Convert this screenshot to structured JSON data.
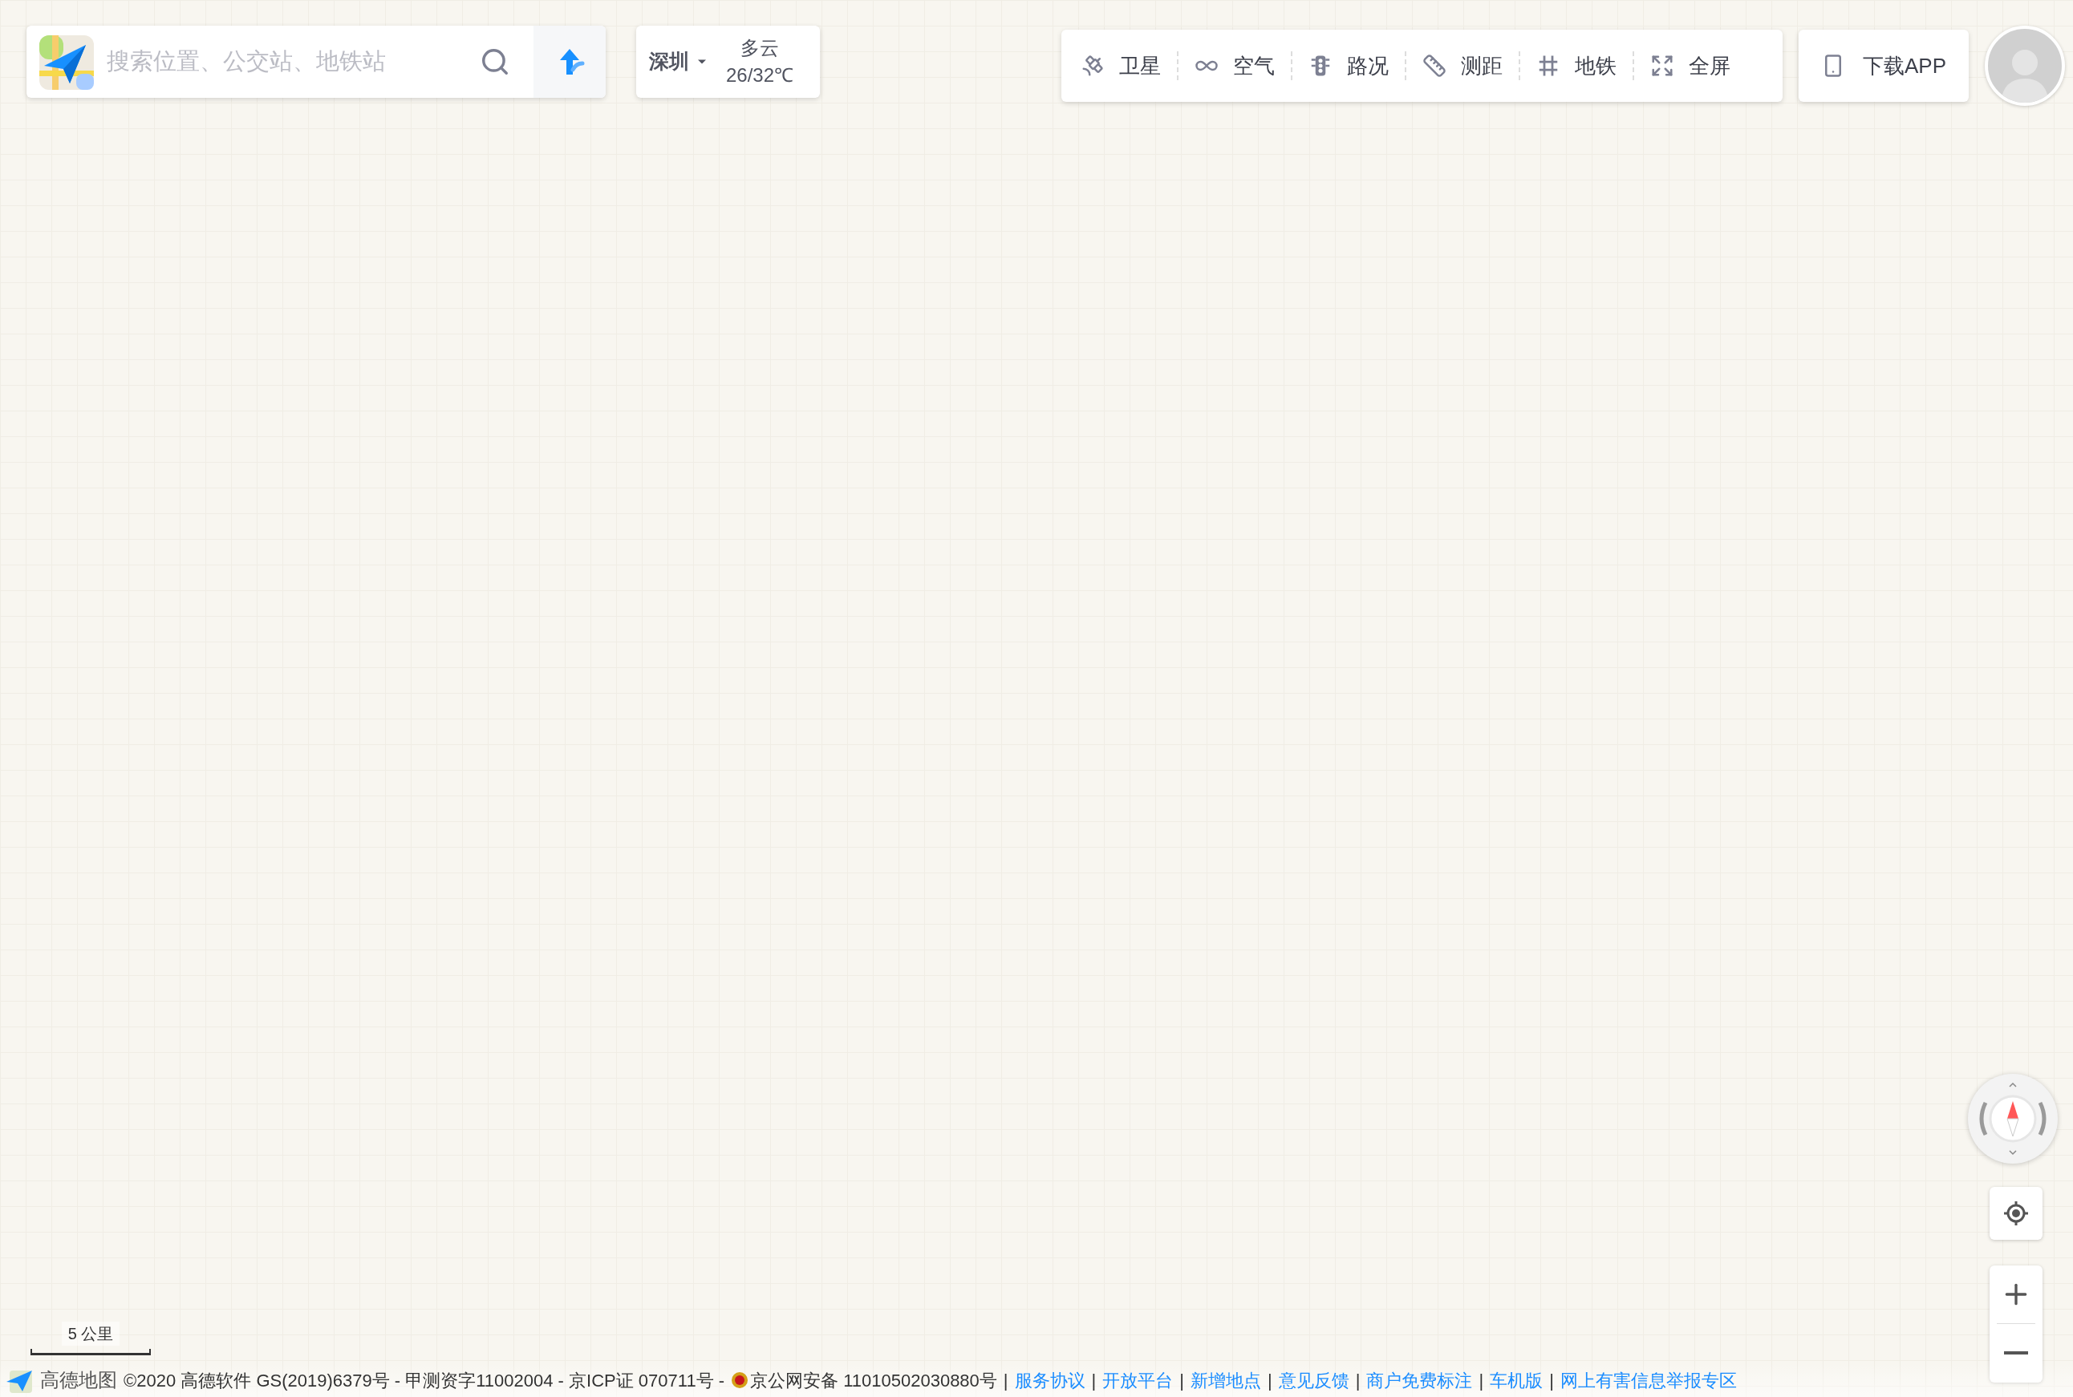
{
  "search": {
    "placeholder": "搜索位置、公交站、地铁站"
  },
  "city": {
    "name": "深圳"
  },
  "weather": {
    "condition": "多云",
    "temperature": "26/32℃"
  },
  "toolbar": [
    {
      "kind": "satellite",
      "label": "卫星"
    },
    {
      "kind": "air",
      "label": "空气"
    },
    {
      "kind": "traffic",
      "label": "路况"
    },
    {
      "kind": "measure",
      "label": "测距"
    },
    {
      "kind": "subway",
      "label": "地铁"
    },
    {
      "kind": "fullscreen",
      "label": "全屏"
    }
  ],
  "download": {
    "label": "下载APP"
  },
  "scale": {
    "label": "5 公里"
  },
  "footer": {
    "logo_text": "高德地图",
    "copyright": "©2020 高德软件 GS(2019)6379号 - 甲测资字11002004 - 京ICP证 070711号 -",
    "police": "京公网安备 11010502030880号",
    "separator": "|",
    "links": [
      "服务协议",
      "开放平台",
      "新增地点",
      "意见反馈",
      "商户免费标注",
      "车机版",
      "网上有害信息举报专区"
    ]
  }
}
